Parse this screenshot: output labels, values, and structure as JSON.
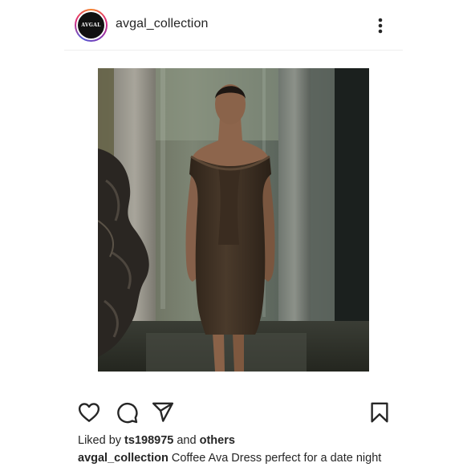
{
  "post": {
    "username": "avgal_collection",
    "avatar_text": "AVGAL",
    "likes": {
      "prefix": "Liked by",
      "user": "ts198975",
      "conjunction": "and",
      "others": "others"
    },
    "caption": {
      "username": "avgal_collection",
      "text": "Coffee Ava Dress perfect for a date night"
    },
    "icons": {
      "more": "more-vertical-icon",
      "like": "heart-icon",
      "comment": "comment-icon",
      "share": "paper-plane-icon",
      "save": "bookmark-icon"
    },
    "colors": {
      "text": "#262626",
      "ring_start": "#f58529",
      "ring_end": "#515bd4",
      "dress": "#3e2f22"
    }
  }
}
